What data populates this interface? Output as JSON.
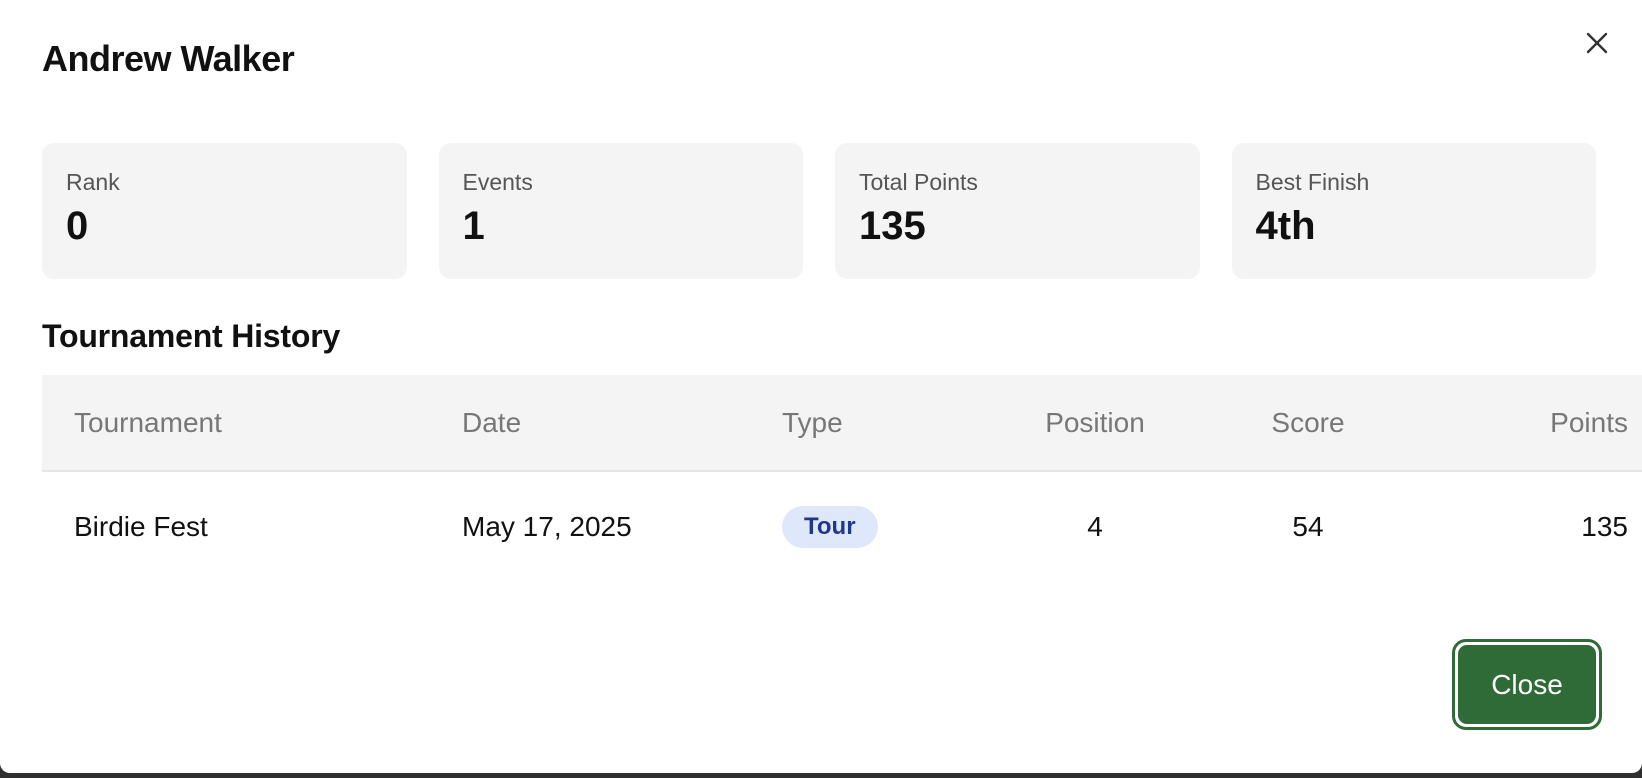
{
  "modal": {
    "title": "Andrew Walker",
    "close_icon": "close-icon",
    "close_button_label": "Close"
  },
  "stats": [
    {
      "label": "Rank",
      "value": "0"
    },
    {
      "label": "Events",
      "value": "1"
    },
    {
      "label": "Total Points",
      "value": "135"
    },
    {
      "label": "Best Finish",
      "value": "4th"
    }
  ],
  "history": {
    "title": "Tournament History",
    "columns": [
      "Tournament",
      "Date",
      "Type",
      "Position",
      "Score",
      "Points"
    ],
    "rows": [
      {
        "tournament": "Birdie Fest",
        "date": "May 17, 2025",
        "type": "Tour",
        "position": "4",
        "score": "54",
        "points": "135"
      }
    ]
  },
  "colors": {
    "primary_green": "#2f6b36",
    "badge_bg": "#dfe8fb",
    "badge_text": "#1d3a8a",
    "card_bg": "#f4f4f4"
  }
}
